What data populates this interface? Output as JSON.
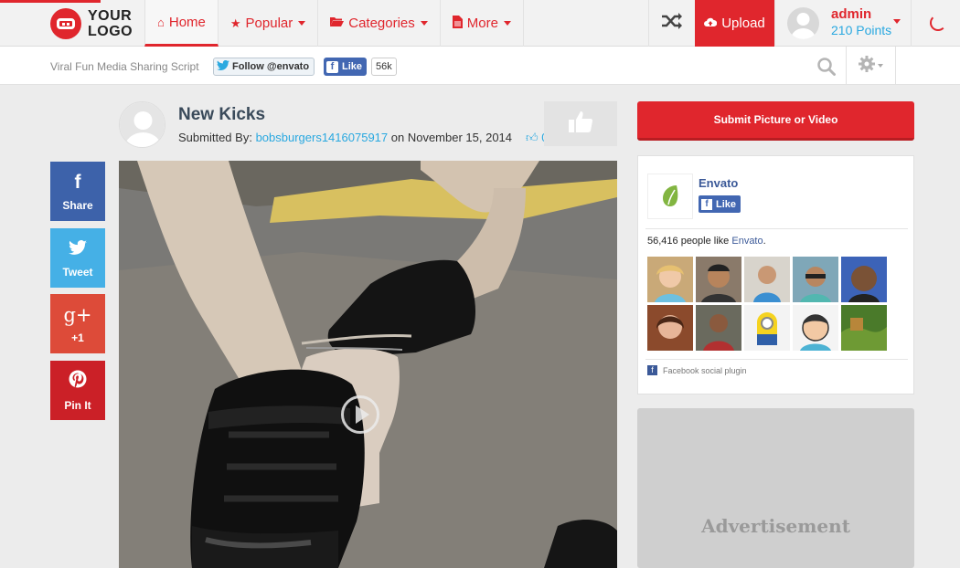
{
  "brand": {
    "logo_line1": "YOUR",
    "logo_line2": "LOGO",
    "accent": "#e0262d",
    "link_color": "#29a8e0"
  },
  "nav": {
    "items": [
      {
        "label": "Home",
        "icon": "home-icon",
        "active": true
      },
      {
        "label": "Popular",
        "icon": "star-icon"
      },
      {
        "label": "Categories",
        "icon": "folder-open-icon"
      },
      {
        "label": "More",
        "icon": "file-icon"
      }
    ],
    "upload_label": "Upload",
    "user": {
      "name": "admin",
      "points": "210 Points"
    }
  },
  "subbar": {
    "tagline": "Viral Fun Media Sharing Script",
    "twitter_follow": "Follow @envato",
    "fb_like": "Like",
    "fb_count": "56k"
  },
  "post": {
    "title": "New Kicks",
    "submitted_prefix": "Submitted By:",
    "username": "bobsburgers1416075917",
    "date_text": "on November 15, 2014",
    "like_count": "0"
  },
  "share": {
    "facebook": "Share",
    "twitter": "Tweet",
    "googleplus": "+1",
    "pinterest": "Pin It",
    "icons": {
      "facebook": "f",
      "twitter": "twitter-bird-icon",
      "googleplus": "g+",
      "pinterest": "pinterest-icon"
    }
  },
  "sidebar": {
    "submit_label": "Submit Picture or Video",
    "fb_page_name": "Envato",
    "fb_like": "Like",
    "fb_people_prefix": "56,416 people like ",
    "fb_people_page": "Envato",
    "fb_people_suffix": ".",
    "fb_plugin": "Facebook social plugin",
    "ad_label": "Advertisement"
  }
}
